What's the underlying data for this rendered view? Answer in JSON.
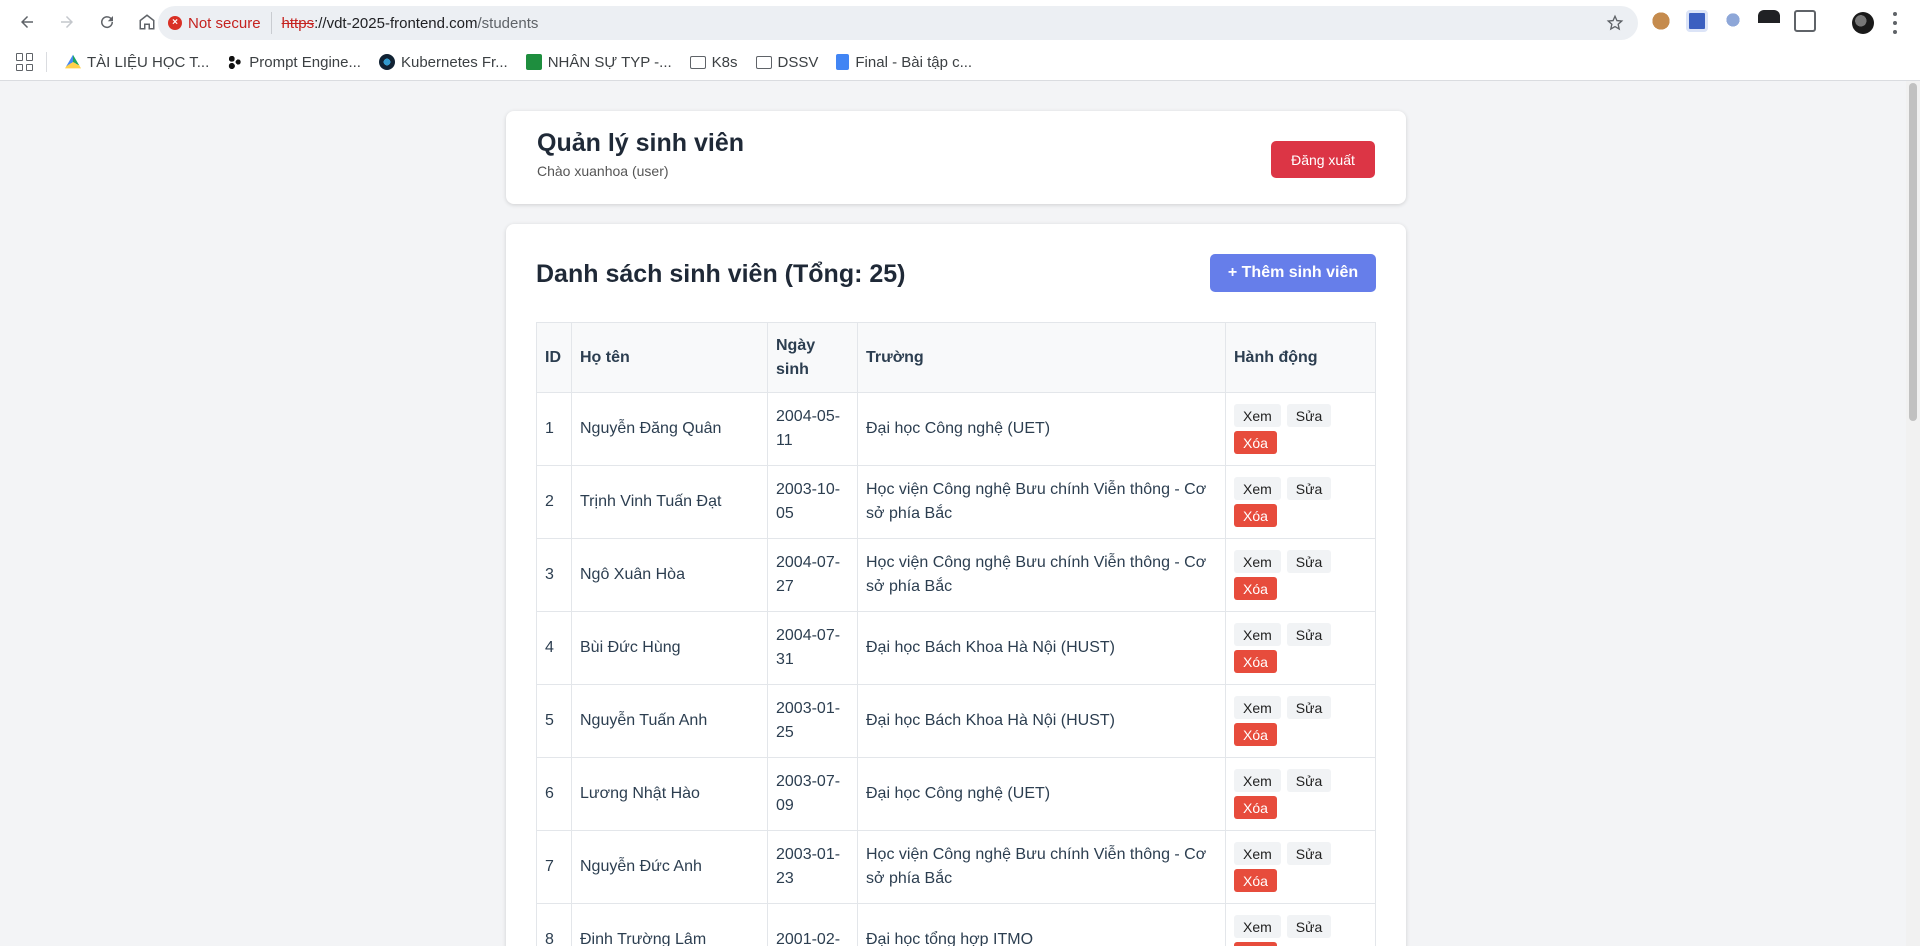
{
  "browser": {
    "security_label": "Not secure",
    "url_scheme": "https",
    "url_host": "://vdt-2025-frontend.com",
    "url_path": "/students",
    "bookmarks": [
      {
        "label": "TÀI LIỆU HỌC T...",
        "icon": "drive-icon"
      },
      {
        "label": "Prompt Engine...",
        "icon": "dots-icon"
      },
      {
        "label": "Kubernetes Fr...",
        "icon": "k8s-icon"
      },
      {
        "label": "NHÂN SỰ TYP -...",
        "icon": "sheets-icon"
      },
      {
        "label": "K8s",
        "icon": "folder-icon"
      },
      {
        "label": "DSSV",
        "icon": "folder-icon"
      },
      {
        "label": "Final - Bài tập c...",
        "icon": "docs-icon"
      }
    ]
  },
  "header": {
    "title": "Quản lý sinh viên",
    "greeting": "Chào xuanhoa (user)",
    "logout_label": "Đăng xuất"
  },
  "list": {
    "title": "Danh sách sinh viên (Tổng: 25)",
    "add_label": "+ Thêm sinh viên",
    "columns": [
      "ID",
      "Họ tên",
      "Ngày sinh",
      "Trường",
      "Hành động"
    ],
    "actions": {
      "view": "Xem",
      "edit": "Sửa",
      "delete": "Xóa"
    },
    "rows": [
      {
        "id": "1",
        "name": "Nguyễn Đăng Quân",
        "dob": "2004-05-11",
        "school": "Đại học Công nghệ (UET)"
      },
      {
        "id": "2",
        "name": "Trịnh Vinh Tuấn Đạt",
        "dob": "2003-10-05",
        "school": "Học viện Công nghệ Bưu chính Viễn thông - Cơ sở phía Bắc"
      },
      {
        "id": "3",
        "name": "Ngô Xuân Hòa",
        "dob": "2004-07-27",
        "school": "Học viện Công nghệ Bưu chính Viễn thông - Cơ sở phía Bắc"
      },
      {
        "id": "4",
        "name": "Bùi Đức Hùng",
        "dob": "2004-07-31",
        "school": "Đại học Bách Khoa Hà Nội (HUST)"
      },
      {
        "id": "5",
        "name": "Nguyễn Tuấn Anh",
        "dob": "2003-01-25",
        "school": "Đại học Bách Khoa Hà Nội (HUST)"
      },
      {
        "id": "6",
        "name": "Lương Nhật Hào",
        "dob": "2003-07-09",
        "school": "Đại học Công nghệ (UET)"
      },
      {
        "id": "7",
        "name": "Nguyễn Đức Anh",
        "dob": "2003-01-23",
        "school": "Học viện Công nghệ Bưu chính Viễn thông - Cơ sở phía Bắc"
      },
      {
        "id": "8",
        "name": "Đinh Trường Lâm",
        "dob": "2001-02-",
        "school": "Đại học tổng hợp ITMO"
      }
    ]
  }
}
